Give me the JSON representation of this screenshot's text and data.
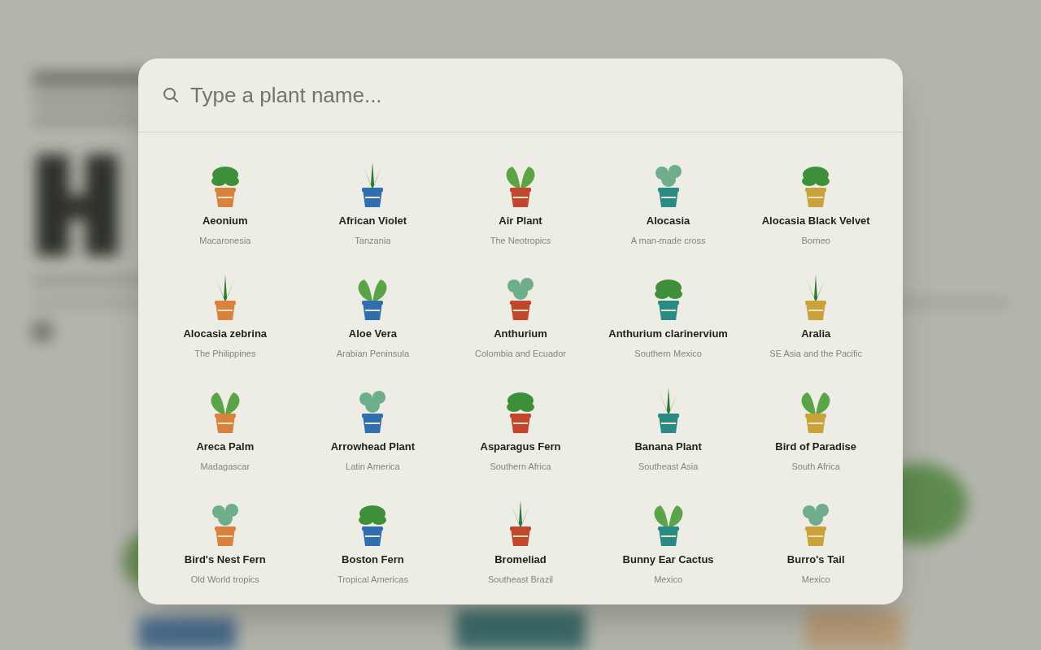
{
  "search": {
    "placeholder": "Type a plant name..."
  },
  "plants": [
    {
      "name": "Aeonium",
      "origin": "Macaronesia"
    },
    {
      "name": "African Violet",
      "origin": "Tanzania"
    },
    {
      "name": "Air Plant",
      "origin": "The Neotropics"
    },
    {
      "name": "Alocasia",
      "origin": "A man-made cross"
    },
    {
      "name": "Alocasia Black Velvet",
      "origin": "Borneo"
    },
    {
      "name": "Alocasia zebrina",
      "origin": "The Philippines"
    },
    {
      "name": "Aloe Vera",
      "origin": "Arabian Peninsula"
    },
    {
      "name": "Anthurium",
      "origin": "Colombia and Ecuador"
    },
    {
      "name": "Anthurium clarinervium",
      "origin": "Southern Mexico"
    },
    {
      "name": "Aralia",
      "origin": "SE Asia and the Pacific"
    },
    {
      "name": "Areca Palm",
      "origin": "Madagascar"
    },
    {
      "name": "Arrowhead Plant",
      "origin": "Latin America"
    },
    {
      "name": "Asparagus Fern",
      "origin": "Southern Africa"
    },
    {
      "name": "Banana Plant",
      "origin": "Southeast Asia"
    },
    {
      "name": "Bird of Paradise",
      "origin": "South Africa"
    },
    {
      "name": "Bird's Nest Fern",
      "origin": "Old World tropics"
    },
    {
      "name": "Boston Fern",
      "origin": "Tropical Americas"
    },
    {
      "name": "Bromeliad",
      "origin": "Southeast Brazil"
    },
    {
      "name": "Bunny Ear Cactus",
      "origin": "Mexico"
    },
    {
      "name": "Burro's Tail",
      "origin": "Mexico"
    }
  ]
}
